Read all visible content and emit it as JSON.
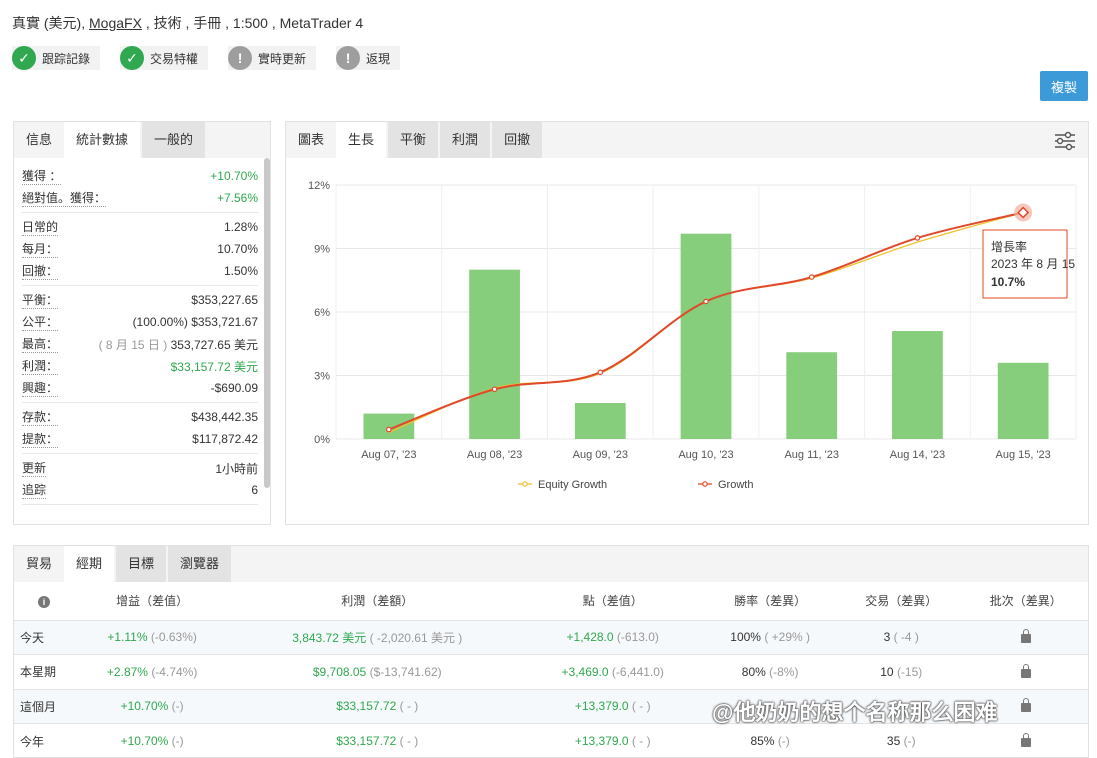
{
  "header": {
    "prefix": "真實 (美元),",
    "broker": "MogaFX",
    "suffix": ", 技術 , 手冊 , 1:500 , MetaTrader 4"
  },
  "badges": [
    {
      "label": "跟踪記錄",
      "state": "ok",
      "icon": "check-icon"
    },
    {
      "label": "交易特權",
      "state": "ok",
      "icon": "check-icon"
    },
    {
      "label": "實時更新",
      "state": "warn",
      "icon": "exclamation-icon"
    },
    {
      "label": "返現",
      "state": "warn",
      "icon": "exclamation-icon"
    }
  ],
  "copy_button": "複製",
  "stats": {
    "tabs": [
      "信息",
      "統計數據",
      "一般的"
    ],
    "groups": [
      [
        {
          "k": "獲得 ：",
          "v": "+10.70%",
          "cls": "green"
        },
        {
          "k": "絕對值。獲得：",
          "v": "+7.56%",
          "cls": "green"
        }
      ],
      [
        {
          "k": "日常的",
          "v": "1.28%"
        },
        {
          "k": "每月：",
          "v": "10.70%"
        },
        {
          "k": "回撤：",
          "v": "1.50%"
        }
      ],
      [
        {
          "k": "平衡：",
          "v": "$353,227.65"
        },
        {
          "k": "公平：",
          "v": "(100.00%) $353,721.67"
        },
        {
          "k": "最高：",
          "pre": "( 8 月 15 日 )",
          "v": "353,727.65 美元"
        },
        {
          "k": "利潤：",
          "v": "$33,157.72 美元",
          "cls": "green"
        },
        {
          "k": "興趣：",
          "v": "-$690.09"
        }
      ],
      [
        {
          "k": "存款：",
          "v": "$438,442.35"
        },
        {
          "k": "提款：",
          "v": "$117,872.42"
        }
      ],
      [
        {
          "k": "更新",
          "v": "1小時前"
        },
        {
          "k": "追踪",
          "v": "6"
        }
      ]
    ]
  },
  "chart_tabs": [
    "圖表",
    "生長",
    "平衡",
    "利潤",
    "回撤"
  ],
  "chart_data": {
    "type": "bar",
    "categories": [
      "Aug 07, '23",
      "Aug 08, '23",
      "Aug 09, '23",
      "Aug 10, '23",
      "Aug 11, '23",
      "Aug 14, '23",
      "Aug 15, '23"
    ],
    "bars": [
      1.2,
      8.0,
      1.7,
      9.7,
      4.1,
      5.1,
      3.6
    ],
    "series": [
      {
        "name": "Equity Growth",
        "type": "line",
        "color": "#f0c030",
        "values": [
          0.3,
          2.4,
          3.1,
          6.5,
          7.6,
          9.3,
          10.7
        ]
      },
      {
        "name": "Growth",
        "type": "line",
        "color": "#e04a2a",
        "values": [
          0.45,
          2.35,
          3.15,
          6.5,
          7.65,
          9.5,
          10.7
        ]
      }
    ],
    "bar_color": "#86cd7c",
    "yticks": [
      "0%",
      "3%",
      "6%",
      "9%",
      "12%"
    ],
    "ylim": [
      0,
      12
    ],
    "tooltip": {
      "title": "增長率",
      "date": "2023 年 8 月 15",
      "value": "10.7%"
    }
  },
  "table": {
    "tabs": [
      "貿易",
      "經期",
      "目標",
      "瀏覽器"
    ],
    "headers": [
      "增益（差值）",
      "利潤（差額）",
      "點（差值）",
      "勝率（差異）",
      "交易（差異）",
      "批次（差異）"
    ],
    "rows": [
      {
        "period": "今天",
        "gain": "+1.11%",
        "gain_d": "(-0.63%)",
        "profit": "3,843.72 美元",
        "profit_d": "( -2,020.61 美元 )",
        "pips": "+1,428.0",
        "pips_d": "(-613.0)",
        "win": "100%",
        "win_d": "( +29% )",
        "trades": "3",
        "trades_d": "( -4 )"
      },
      {
        "period": "本星期",
        "gain": "+2.87%",
        "gain_d": "(-4.74%)",
        "profit": "$9,708.05",
        "profit_d": "($-13,741.62)",
        "pips": "+3,469.0",
        "pips_d": "(-6,441.0)",
        "win": "80%",
        "win_d": "(-8%)",
        "trades": "10",
        "trades_d": "(-15)"
      },
      {
        "period": "這個月",
        "gain": "+10.70%",
        "gain_d": "(-)",
        "profit": "$33,157.72",
        "profit_d": "( - )",
        "pips": "+13,379.0",
        "pips_d": "( - )",
        "win": "",
        "win_d": "",
        "trades": "",
        "trades_d": ""
      },
      {
        "period": "今年",
        "gain": "+10.70%",
        "gain_d": "(-)",
        "profit": "$33,157.72",
        "profit_d": "( - )",
        "pips": "+13,379.0",
        "pips_d": "( - )",
        "win": "85%",
        "win_d": "(-)",
        "trades": "35",
        "trades_d": "(-)"
      }
    ]
  },
  "watermark": "@他奶奶的想个名称那么困难"
}
